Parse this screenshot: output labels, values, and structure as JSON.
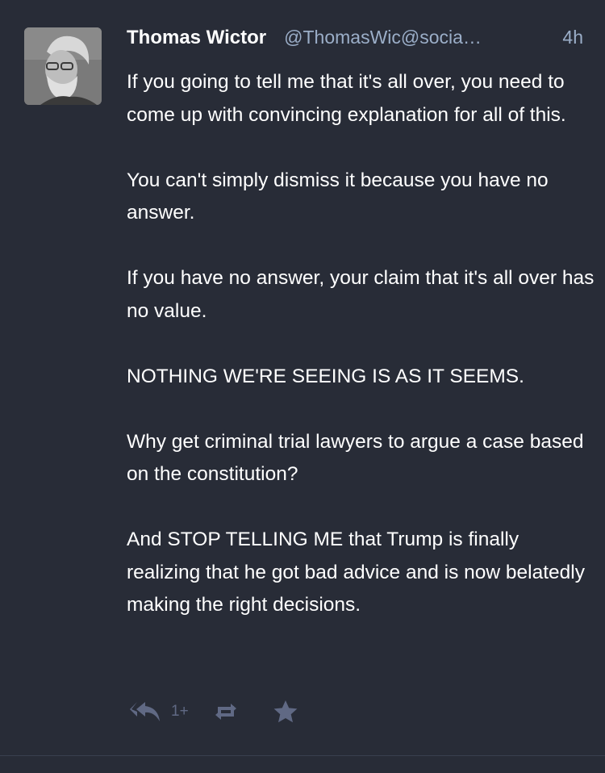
{
  "status": {
    "author": {
      "display_name": "Thomas Wictor",
      "acct": "@ThomasWic@socia…",
      "avatar_icon": "avatar-photo"
    },
    "time": "4h",
    "paragraphs": [
      "If you going to tell me that it's all over, you need to come up with convincing explanation for all of this.",
      "You can't simply dismiss it because you have no answer.",
      "If you have no answer, your claim that it's all over has no value.",
      "NOTHING WE'RE SEEING IS AS IT SEEMS.",
      "Why get criminal trial lawyers to argue a case based on the constitution?",
      "And STOP TELLING ME that Trump is finally realizing that he got bad advice and is now belatedly making the right decisions."
    ],
    "actions": {
      "reply_icon": "reply-all-icon",
      "reply_count": "1+",
      "boost_icon": "boost-icon",
      "favourite_icon": "star-icon"
    }
  },
  "colors": {
    "background": "#282c37",
    "text": "#ffffff",
    "secondary_text": "#9baec8",
    "action_icons": "#606984"
  }
}
